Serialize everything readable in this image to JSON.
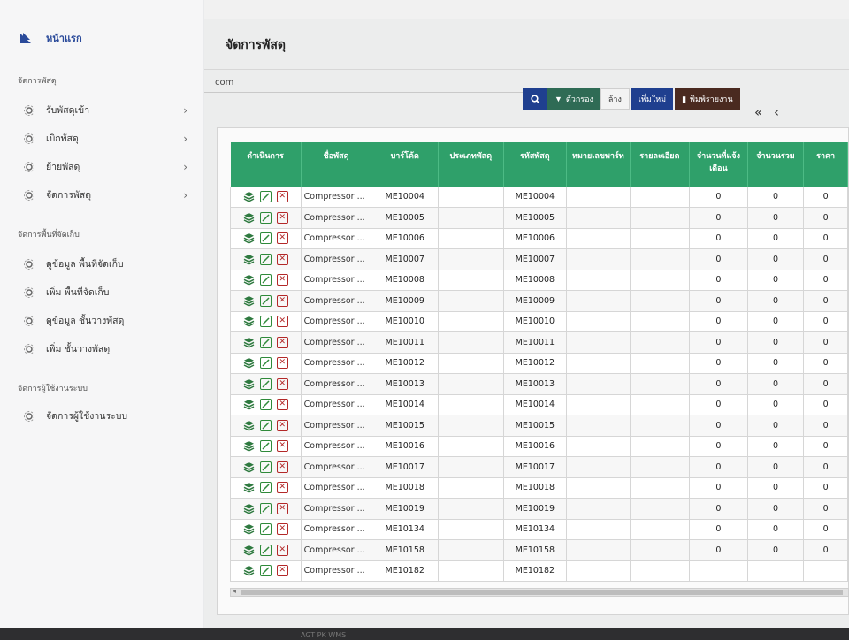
{
  "sidebar": {
    "home_label": "หน้าแรก",
    "sections": [
      {
        "title": "จัดการพัสดุ",
        "items": [
          {
            "label": "รับพัสดุเข้า"
          },
          {
            "label": "เบิกพัสดุ"
          },
          {
            "label": "ย้ายพัสดุ"
          },
          {
            "label": "จัดการพัสดุ"
          }
        ]
      },
      {
        "title": "จัดการพื้นที่จัดเก็บ",
        "items": [
          {
            "label": "ดูข้อมูล พื้นที่จัดเก็บ"
          },
          {
            "label": "เพิ่ม พื้นที่จัดเก็บ"
          },
          {
            "label": "ดูข้อมูล ชั้นวางพัสดุ"
          },
          {
            "label": "เพิ่ม ชั้นวางพัสดุ"
          }
        ]
      },
      {
        "title": "จัดการผู้ใช้งานระบบ",
        "items": [
          {
            "label": "จัดการผู้ใช้งานระบบ"
          }
        ]
      }
    ]
  },
  "page": {
    "title": "จัดการพัสดุ",
    "search_value": "com"
  },
  "toolbar": {
    "filter_label": "ตัวกรอง",
    "clear_label": "ล้าง",
    "add_label": "เพิ่มใหม่",
    "print_label": "พิมพ์รายงาน",
    "pager": "« ‹"
  },
  "table": {
    "headers": [
      "ดำเนินการ",
      "ชื่อพัสดุ",
      "บาร์โค้ด",
      "ประเภทพัสดุ",
      "รหัสพัสดุ",
      "หมายเลขพาร์ท",
      "รายละเอียด",
      "จำนวนที่แจ้งเดือน",
      "จำนวนรวม",
      "ราคา"
    ],
    "rows": [
      {
        "name": "Compressor ...",
        "barcode": "ME10004",
        "code": "ME10004",
        "monthly": "0",
        "total": "0",
        "price": "0"
      },
      {
        "name": "Compressor ...",
        "barcode": "ME10005",
        "code": "ME10005",
        "monthly": "0",
        "total": "0",
        "price": "0"
      },
      {
        "name": "Compressor ...",
        "barcode": "ME10006",
        "code": "ME10006",
        "monthly": "0",
        "total": "0",
        "price": "0"
      },
      {
        "name": "Compressor ...",
        "barcode": "ME10007",
        "code": "ME10007",
        "monthly": "0",
        "total": "0",
        "price": "0"
      },
      {
        "name": "Compressor ...",
        "barcode": "ME10008",
        "code": "ME10008",
        "monthly": "0",
        "total": "0",
        "price": "0"
      },
      {
        "name": "Compressor ...",
        "barcode": "ME10009",
        "code": "ME10009",
        "monthly": "0",
        "total": "0",
        "price": "0"
      },
      {
        "name": "Compressor ...",
        "barcode": "ME10010",
        "code": "ME10010",
        "monthly": "0",
        "total": "0",
        "price": "0"
      },
      {
        "name": "Compressor ...",
        "barcode": "ME10011",
        "code": "ME10011",
        "monthly": "0",
        "total": "0",
        "price": "0"
      },
      {
        "name": "Compressor ...",
        "barcode": "ME10012",
        "code": "ME10012",
        "monthly": "0",
        "total": "0",
        "price": "0"
      },
      {
        "name": "Compressor ...",
        "barcode": "ME10013",
        "code": "ME10013",
        "monthly": "0",
        "total": "0",
        "price": "0"
      },
      {
        "name": "Compressor ...",
        "barcode": "ME10014",
        "code": "ME10014",
        "monthly": "0",
        "total": "0",
        "price": "0"
      },
      {
        "name": "Compressor ...",
        "barcode": "ME10015",
        "code": "ME10015",
        "monthly": "0",
        "total": "0",
        "price": "0"
      },
      {
        "name": "Compressor ...",
        "barcode": "ME10016",
        "code": "ME10016",
        "monthly": "0",
        "total": "0",
        "price": "0"
      },
      {
        "name": "Compressor ...",
        "barcode": "ME10017",
        "code": "ME10017",
        "monthly": "0",
        "total": "0",
        "price": "0"
      },
      {
        "name": "Compressor ...",
        "barcode": "ME10018",
        "code": "ME10018",
        "monthly": "0",
        "total": "0",
        "price": "0"
      },
      {
        "name": "Compressor ...",
        "barcode": "ME10019",
        "code": "ME10019",
        "monthly": "0",
        "total": "0",
        "price": "0"
      },
      {
        "name": "Compressor ...",
        "barcode": "ME10134",
        "code": "ME10134",
        "monthly": "0",
        "total": "0",
        "price": "0"
      },
      {
        "name": "Compressor ...",
        "barcode": "ME10158",
        "code": "ME10158",
        "monthly": "0",
        "total": "0",
        "price": "0"
      },
      {
        "name": "Compressor ...",
        "barcode": "ME10182",
        "code": "ME10182",
        "monthly": "",
        "total": "",
        "price": ""
      }
    ]
  },
  "footer": {
    "text": "AGT PK WMS"
  },
  "colors": {
    "header_green": "#2fa06a",
    "nav_blue": "#1f3f8f",
    "filter_green": "#2f6b55",
    "print_brown": "#4a2a20",
    "delete_red": "#b32828"
  }
}
